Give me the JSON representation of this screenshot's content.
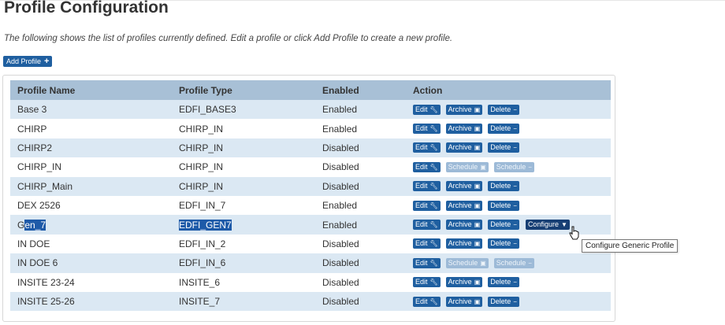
{
  "page": {
    "title": "Profile Configuration",
    "description": "The following shows the list of profiles currently defined. Edit a profile or click Add Profile to create a new profile.",
    "add_profile_label": "Add Profile",
    "add_profile_icon": "+"
  },
  "table": {
    "headers": [
      "Profile Name",
      "Profile Type",
      "Enabled",
      "Action"
    ],
    "rows": [
      {
        "name": "Base 3",
        "type": "EDFI_BASE3",
        "enabled": "Enabled"
      },
      {
        "name": "CHIRP",
        "type": "CHIRP_IN",
        "enabled": "Enabled"
      },
      {
        "name": "CHIRP2",
        "type": "CHIRP_IN",
        "enabled": "Disabled"
      },
      {
        "name": "CHIRP_IN",
        "type": "CHIRP_IN",
        "enabled": "Disabled"
      },
      {
        "name": "CHIRP_Main",
        "type": "CHIRP_IN",
        "enabled": "Disabled"
      },
      {
        "name": "DEX 2526",
        "type": "EDFI_IN_7",
        "enabled": "Enabled"
      },
      {
        "name_pre": "G",
        "name_sel": "en_7",
        "type": "EDFI_GEN7",
        "enabled": "Enabled"
      },
      {
        "name": "IN DOE",
        "type": "EDFI_IN_2",
        "enabled": "Disabled"
      },
      {
        "name": "IN DOE 6",
        "type": "EDFI_IN_6",
        "enabled": "Disabled"
      },
      {
        "name": "INSITE 23-24",
        "type": "INSITE_6",
        "enabled": "Disabled"
      },
      {
        "name": "INSITE 25-26",
        "type": "INSITE_7",
        "enabled": "Disabled"
      }
    ]
  },
  "actions": {
    "edit": "Edit",
    "archive": "Archive",
    "delete": "Delete",
    "schedule": "Schedule",
    "configure": "Configure"
  },
  "tooltip": "Configure Generic Profile"
}
